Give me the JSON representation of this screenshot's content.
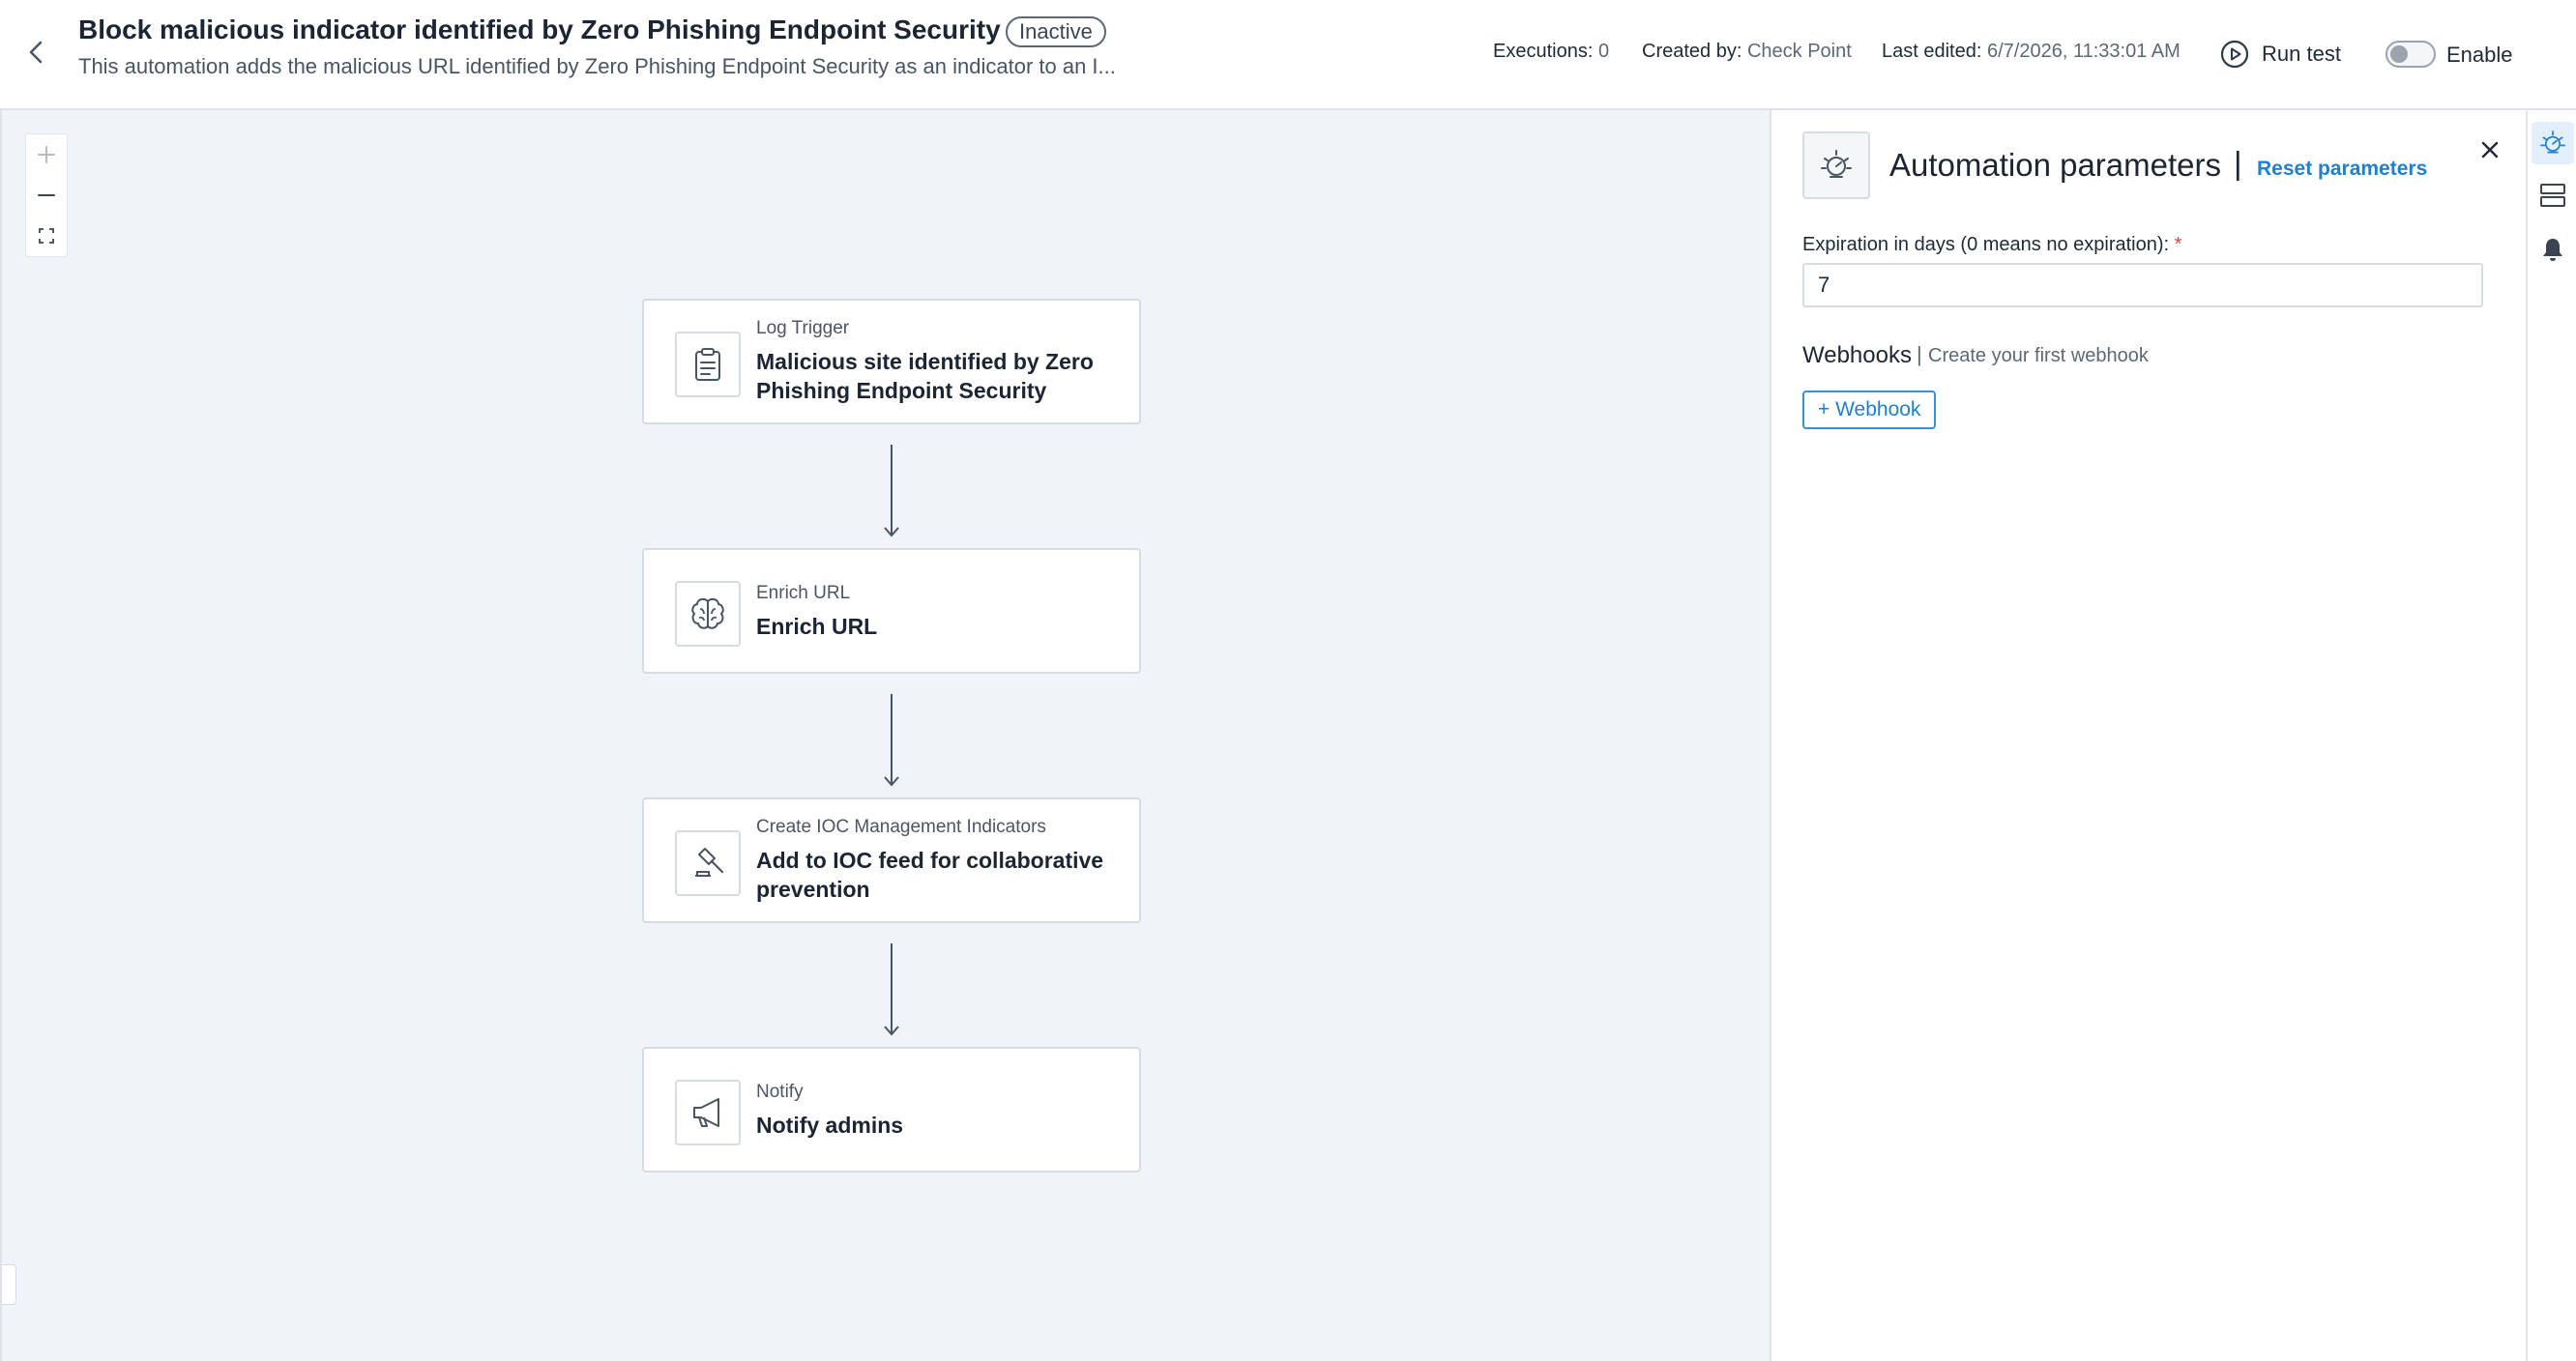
{
  "header": {
    "title": "Block malicious indicator identified by Zero Phishing Endpoint Security",
    "status": "Inactive",
    "description": "This automation adds the malicious URL identified by Zero Phishing Endpoint Security as an indicator to an I...",
    "executions_label": "Executions:",
    "executions_value": "0",
    "created_by_label": "Created by:",
    "created_by_value": "Check Point",
    "last_edited_label": "Last edited:",
    "last_edited_value": "6/7/2026, 11:33:01 AM",
    "run_test_label": "Run test",
    "enable_label": "Enable",
    "enabled": false
  },
  "canvas": {
    "zoom_in_label": "+",
    "nodes": [
      {
        "type": "Log Trigger",
        "name": "Malicious site identified by Zero Phishing Endpoint Security",
        "icon": "clipboard-icon"
      },
      {
        "type": "Enrich URL",
        "name": "Enrich URL",
        "icon": "brain-icon"
      },
      {
        "type": "Create IOC Management Indicators",
        "name": "Add to IOC feed for collaborative prevention",
        "icon": "gavel-icon"
      },
      {
        "type": "Notify",
        "name": "Notify admins",
        "icon": "megaphone-icon"
      }
    ]
  },
  "panel": {
    "title": "Automation parameters",
    "separator": "|",
    "reset_label": "Reset parameters",
    "expiration_label": "Expiration in days (0 means no expiration):",
    "required_mark": "*",
    "expiration_value": "7",
    "webhooks_title": "Webhooks",
    "webhooks_separator": "|",
    "webhooks_hint": "Create your first webhook",
    "add_webhook_label": "+ Webhook"
  },
  "colors": {
    "accent": "#1f7fd1",
    "canvas_bg": "#f0f3f7",
    "border": "#d7dce3",
    "required": "#d64545"
  }
}
